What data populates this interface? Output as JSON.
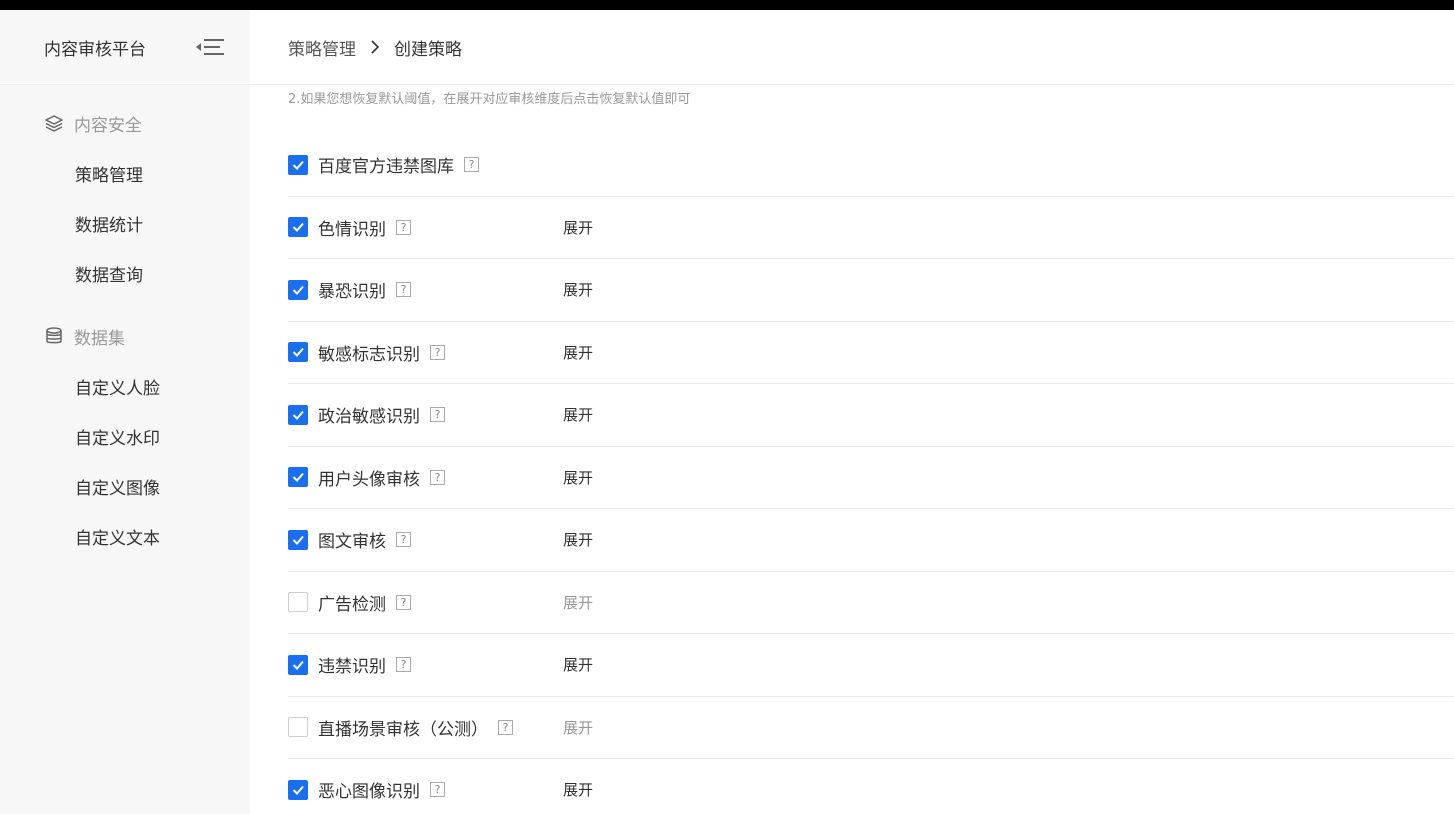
{
  "sidebar": {
    "title": "内容审核平台",
    "groups": [
      {
        "label": "内容安全",
        "icon": "layers-icon",
        "items": [
          "策略管理",
          "数据统计",
          "数据查询"
        ]
      },
      {
        "label": "数据集",
        "icon": "database-icon",
        "items": [
          "自定义人脸",
          "自定义水印",
          "自定义图像",
          "自定义文本"
        ]
      }
    ]
  },
  "breadcrumb": {
    "parent": "策略管理",
    "current": "创建策略"
  },
  "hint": "2.如果您想恢复默认阈值，在展开对应审核维度后点击恢复默认值即可",
  "expand_label": "展开",
  "help_glyph": "?",
  "accent_color": "#1a6ef0",
  "rows": [
    {
      "label": "百度官方违禁图库",
      "checked": true,
      "expandable": false
    },
    {
      "label": "色情识别",
      "checked": true,
      "expandable": true
    },
    {
      "label": "暴恐识别",
      "checked": true,
      "expandable": true
    },
    {
      "label": "敏感标志识别",
      "checked": true,
      "expandable": true
    },
    {
      "label": "政治敏感识别",
      "checked": true,
      "expandable": true
    },
    {
      "label": "用户头像审核",
      "checked": true,
      "expandable": true
    },
    {
      "label": "图文审核",
      "checked": true,
      "expandable": true
    },
    {
      "label": "广告检测",
      "checked": false,
      "expandable": true
    },
    {
      "label": "违禁识别",
      "checked": true,
      "expandable": true
    },
    {
      "label": "直播场景审核（公测）",
      "checked": false,
      "expandable": true
    },
    {
      "label": "恶心图像识别",
      "checked": true,
      "expandable": true
    }
  ]
}
